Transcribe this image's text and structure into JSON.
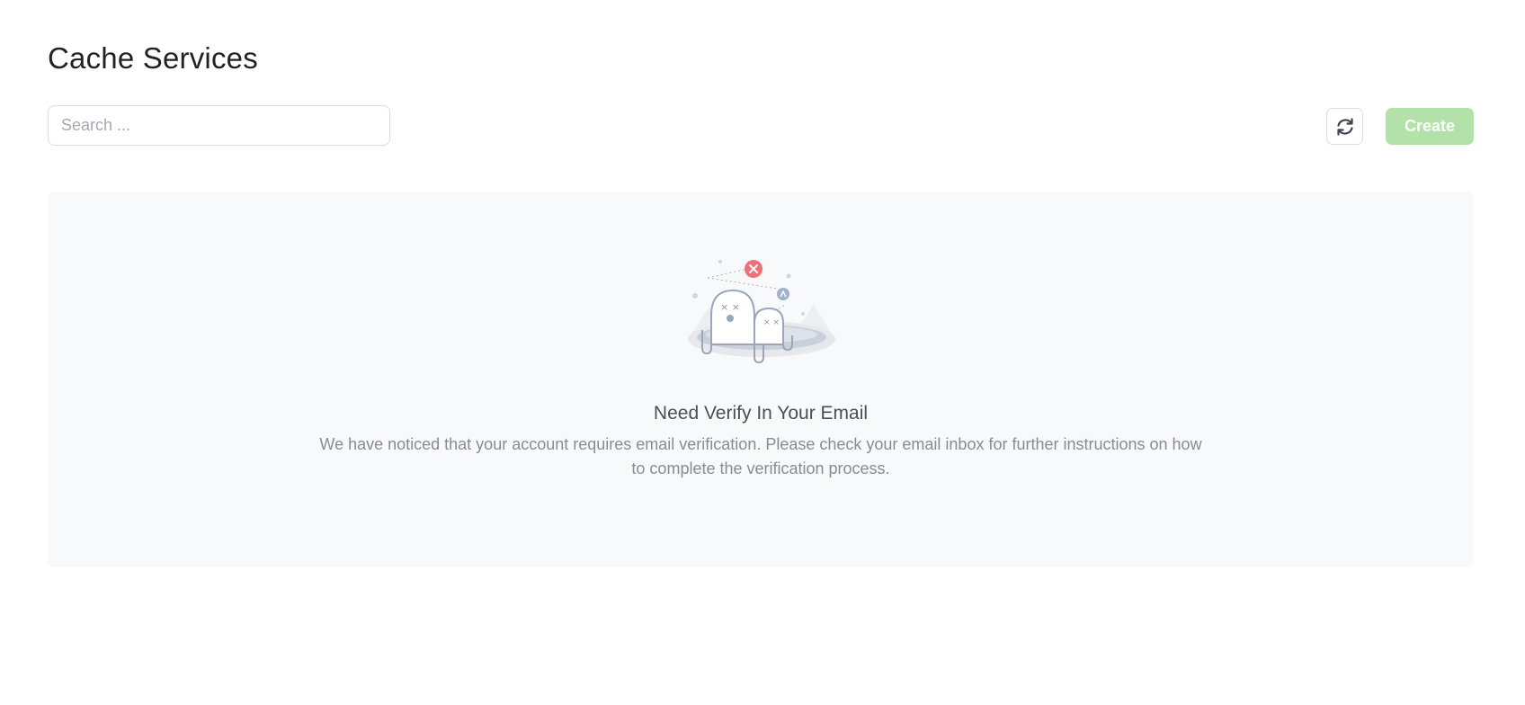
{
  "header": {
    "title": "Cache Services"
  },
  "toolbar": {
    "search_placeholder": "Search ...",
    "search_value": "",
    "refresh_icon": "refresh-icon",
    "create_label": "Create",
    "create_color": "#b3e2a8"
  },
  "empty_state": {
    "illustration": "empty-state-ghosts-illustration",
    "title": "Need Verify In Your Email",
    "description": "We have noticed that your account requires email verification. Please check your email inbox for further instructions on how to complete the verification process."
  }
}
